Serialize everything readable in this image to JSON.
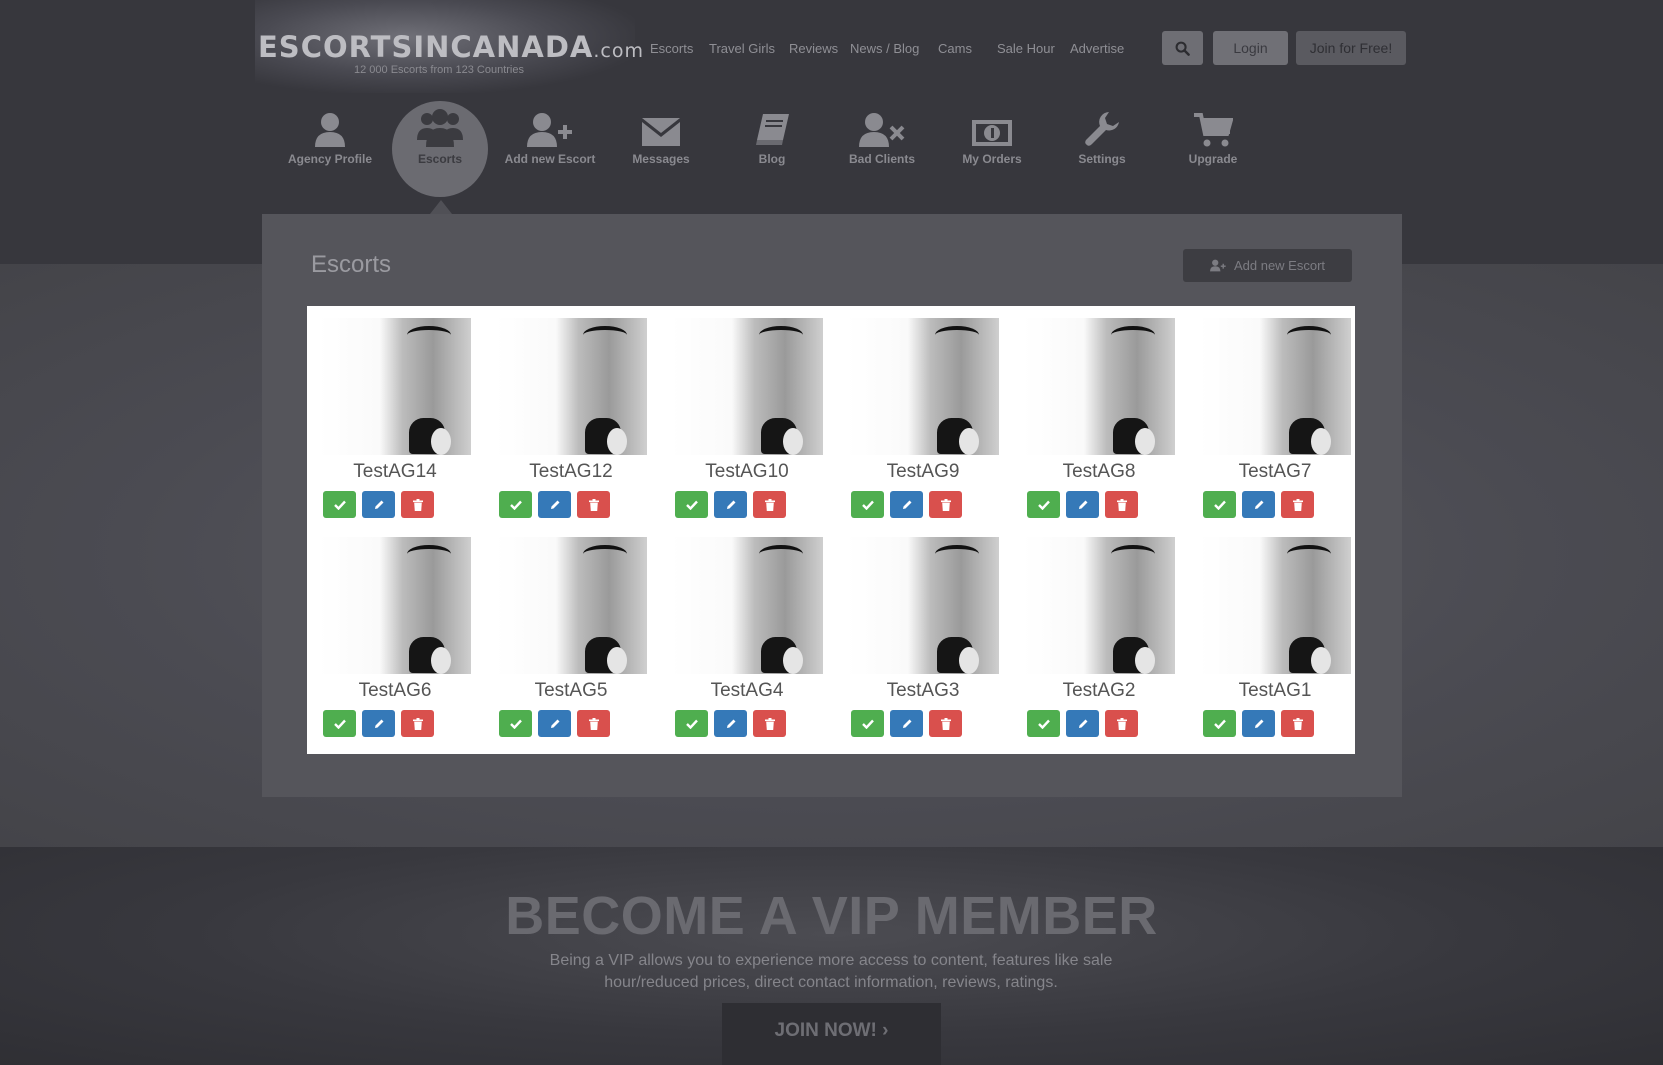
{
  "header": {
    "logo_text": "ESCORTSINCANADA",
    "logo_suffix": ".com",
    "tagline": "12 000 Escorts from 123 Countries",
    "nav": [
      "Escorts",
      "Travel Girls",
      "Reviews",
      "News / Blog",
      "Cams",
      "Sale Hour",
      "Advertise"
    ],
    "login_label": "Login",
    "join_label": "Join for Free!"
  },
  "iconnav": {
    "items": [
      {
        "label": "Agency Profile",
        "icon": "user-icon"
      },
      {
        "label": "Escorts",
        "icon": "users-icon",
        "active": true
      },
      {
        "label": "Add new Escort",
        "icon": "user-plus-icon"
      },
      {
        "label": "Messages",
        "icon": "envelope-icon"
      },
      {
        "label": "Blog",
        "icon": "book-icon"
      },
      {
        "label": "Bad Clients",
        "icon": "user-times-icon"
      },
      {
        "label": "My Orders",
        "icon": "money-icon"
      },
      {
        "label": "Settings",
        "icon": "wrench-icon"
      },
      {
        "label": "Upgrade",
        "icon": "cart-icon"
      }
    ]
  },
  "main": {
    "title": "Escorts",
    "add_button_label": "Add new Escort",
    "escorts": [
      "TestAG14",
      "TestAG12",
      "TestAG10",
      "TestAG9",
      "TestAG8",
      "TestAG7",
      "TestAG6",
      "TestAG5",
      "TestAG4",
      "TestAG3",
      "TestAG2",
      "TestAG1"
    ]
  },
  "footer": {
    "vip_title": "BECOME A VIP MEMBER",
    "vip_text": "Being a VIP allows you to experience more access to content, features like sale hour/reduced prices, direct contact information, reviews, ratings.",
    "join_now_label": "JOIN NOW!",
    "join_now_arrow": "›"
  },
  "colors": {
    "approve": "#4fae4f",
    "edit": "#3579b8",
    "delete": "#d9504d"
  }
}
